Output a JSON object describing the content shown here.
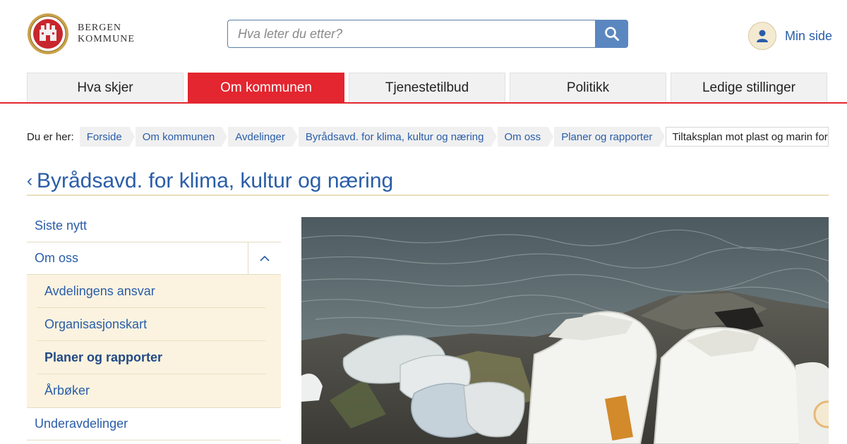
{
  "header": {
    "logo_line1": "BERGEN",
    "logo_line2": "KOMMUNE",
    "search_placeholder": "Hva leter du etter?",
    "search_icon": "search-icon",
    "user_icon": "user-icon",
    "minside_label": "Min side"
  },
  "nav": {
    "tabs": [
      {
        "label": "Hva skjer",
        "active": false
      },
      {
        "label": "Om kommunen",
        "active": true
      },
      {
        "label": "Tjenestetilbud",
        "active": false
      },
      {
        "label": "Politikk",
        "active": false
      },
      {
        "label": "Ledige stillinger",
        "active": false
      }
    ]
  },
  "breadcrumb": {
    "label": "Du er her:",
    "items": [
      "Forside",
      "Om kommunen",
      "Avdelinger",
      "Byrådsavd. for klima, kultur og næring",
      "Om oss",
      "Planer og rapporter"
    ],
    "current": "Tiltaksplan mot plast og marin forsøpling"
  },
  "section": {
    "back_icon": "chevron-left-icon",
    "title": "Byrådsavd. for klima, kultur og næring"
  },
  "sidemenu": {
    "items": [
      {
        "label": "Siste nytt"
      },
      {
        "label": "Om oss",
        "expanded": true
      },
      {
        "label": "Underavdelinger"
      }
    ],
    "sub_items": [
      {
        "label": "Avdelingens ansvar",
        "current": false
      },
      {
        "label": "Organisasjonskart",
        "current": false
      },
      {
        "label": "Planer og rapporter",
        "current": true
      },
      {
        "label": "Årbøker",
        "current": false
      }
    ],
    "toggle_icon": "chevron-up-icon"
  },
  "colors": {
    "accent_red": "#e3262f",
    "link_blue": "#2a5da8",
    "search_blue": "#5b87c0",
    "submenu_bg": "#fbf3e0"
  }
}
